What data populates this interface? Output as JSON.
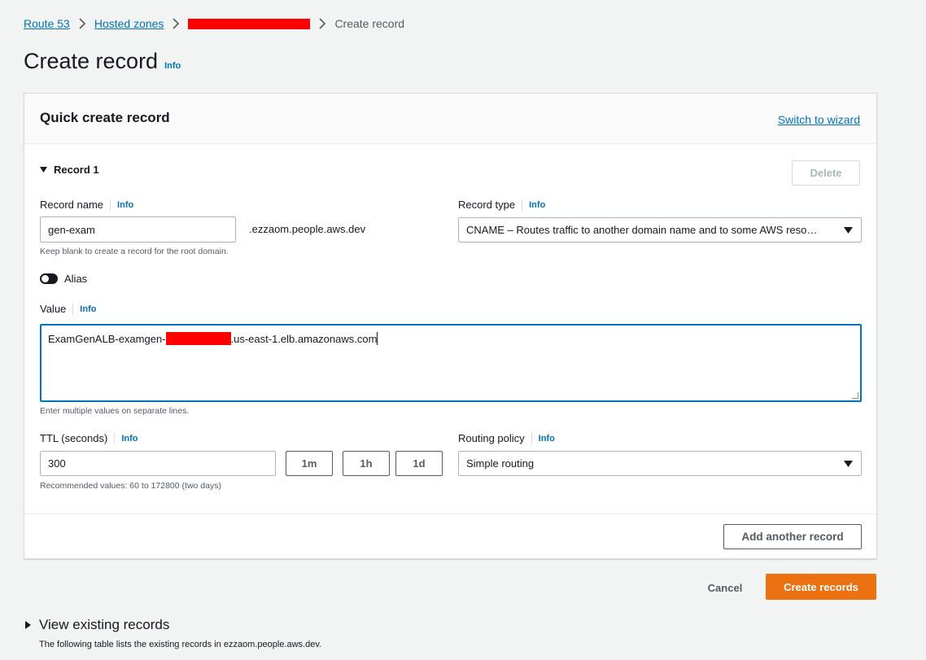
{
  "breadcrumb": {
    "items": [
      "Route 53",
      "Hosted zones"
    ],
    "current": "Create record"
  },
  "page": {
    "title": "Create record",
    "info": "Info"
  },
  "panel": {
    "title": "Quick create record",
    "switch_to_wizard": "Switch to wizard"
  },
  "record": {
    "heading": "Record 1",
    "delete_label": "Delete",
    "record_name": {
      "label": "Record name",
      "info": "Info",
      "value": "gen-exam",
      "suffix": ".ezzaom.people.aws.dev",
      "hint": "Keep blank to create a record for the root domain."
    },
    "record_type": {
      "label": "Record type",
      "info": "Info",
      "value": "CNAME – Routes traffic to another domain name and to some AWS reso…"
    },
    "alias_label": "Alias",
    "value_field": {
      "label": "Value",
      "info": "Info",
      "value_prefix": "ExamGenALB-examgen-",
      "value_suffix": ".us-east-1.elb.amazonaws.com",
      "hint": "Enter multiple values on separate lines."
    },
    "ttl": {
      "label": "TTL (seconds)",
      "info": "Info",
      "value": "300",
      "presets": [
        "1m",
        "1h",
        "1d"
      ],
      "hint": "Recommended values: 60 to 172800 (two days)"
    },
    "routing_policy": {
      "label": "Routing policy",
      "info": "Info",
      "value": "Simple routing"
    }
  },
  "add_another_label": "Add another record",
  "actions": {
    "cancel": "Cancel",
    "create": "Create records"
  },
  "existing": {
    "title": "View existing records",
    "description": "The following table lists the existing records in ezzaom.people.aws.dev."
  },
  "colors": {
    "link": "#0073bb",
    "primary": "#ec7211",
    "redaction": "#ff0000",
    "background": "#f2f3f3"
  },
  "icons": {
    "breadcrumb_separator": "chevron-right-icon",
    "expand": "caret-down-icon",
    "collapse": "caret-right-icon",
    "select": "caret-down-icon"
  }
}
